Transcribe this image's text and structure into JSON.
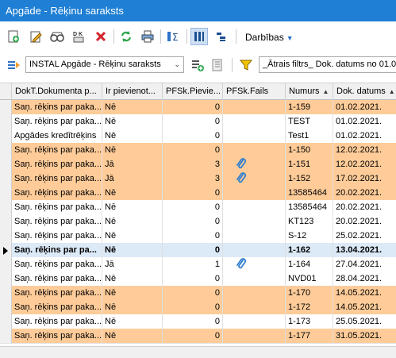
{
  "window": {
    "title": "Apgāde - Rēķinu saraksts"
  },
  "toolbar": {
    "actions_label": "Darbības",
    "icons": [
      "new-doc-icon",
      "edit-icon",
      "view-icon",
      "dk-icon",
      "delete-icon",
      "refresh-icon",
      "print-icon",
      "sum-icon",
      "columns-icon",
      "tree-icon"
    ]
  },
  "toolbar2": {
    "report_select_value": "INSTAL Apgāde - Rēķinu saraksts",
    "filter_text": "_Ātrais filtrs_ Dok. datums no 01.01"
  },
  "colors": {
    "title_bar": "#1e7fd4",
    "row_highlight": "#ffcc99",
    "row_selected": "#dce9f7",
    "attachment": "#2f7fd0"
  },
  "grid": {
    "columns": [
      "DokT.Dokumenta p...",
      "Ir pievienot...",
      "PFSk.Pievie...",
      "PFSk.Fails",
      "Numurs",
      "Dok. datums"
    ],
    "sorted_column_index": 5,
    "rows": [
      {
        "doc": "Saņ. rēķins par paka...",
        "attached": "Nē",
        "count": "0",
        "file": false,
        "number": "1-159",
        "date": "01.02.2021.",
        "style": "orange"
      },
      {
        "doc": "Saņ. rēķins par paka...",
        "attached": "Nē",
        "count": "0",
        "file": false,
        "number": "TEST",
        "date": "01.02.2021.",
        "style": "white"
      },
      {
        "doc": "Apgādes kredītrēķins",
        "attached": "Nē",
        "count": "0",
        "file": false,
        "number": "Test1",
        "date": "01.02.2021.",
        "style": "white"
      },
      {
        "doc": "Saņ. rēķins par paka...",
        "attached": "Nē",
        "count": "0",
        "file": false,
        "number": "1-150",
        "date": "12.02.2021.",
        "style": "orange"
      },
      {
        "doc": "Saņ. rēķins par paka...",
        "attached": "Jā",
        "count": "3",
        "file": true,
        "number": "1-151",
        "date": "12.02.2021.",
        "style": "orange"
      },
      {
        "doc": "Saņ. rēķins par paka...",
        "attached": "Jā",
        "count": "3",
        "file": true,
        "number": "1-152",
        "date": "17.02.2021.",
        "style": "orange"
      },
      {
        "doc": "Saņ. rēķins par paka...",
        "attached": "Nē",
        "count": "0",
        "file": false,
        "number": "13585464",
        "date": "20.02.2021.",
        "style": "orange"
      },
      {
        "doc": "Saņ. rēķins par paka...",
        "attached": "Nē",
        "count": "0",
        "file": false,
        "number": "13585464",
        "date": "20.02.2021.",
        "style": "white"
      },
      {
        "doc": "Saņ. rēķins par paka...",
        "attached": "Nē",
        "count": "0",
        "file": false,
        "number": "KT123",
        "date": "20.02.2021.",
        "style": "white"
      },
      {
        "doc": "Saņ. rēķins par paka...",
        "attached": "Nē",
        "count": "0",
        "file": false,
        "number": "S-12",
        "date": "25.02.2021.",
        "style": "white"
      },
      {
        "doc": "Saņ. rēķins par pa...",
        "attached": "Nē",
        "count": "0",
        "file": false,
        "number": "1-162",
        "date": "13.04.2021.",
        "style": "sel",
        "current": true
      },
      {
        "doc": "Saņ. rēķins par paka...",
        "attached": "Jā",
        "count": "1",
        "file": true,
        "number": "1-164",
        "date": "27.04.2021.",
        "style": "white"
      },
      {
        "doc": "Saņ. rēķins par paka...",
        "attached": "Nē",
        "count": "0",
        "file": false,
        "number": "NVD01",
        "date": "28.04.2021.",
        "style": "white"
      },
      {
        "doc": "Saņ. rēķins par paka...",
        "attached": "Nē",
        "count": "0",
        "file": false,
        "number": "1-170",
        "date": "14.05.2021.",
        "style": "orange"
      },
      {
        "doc": "Saņ. rēķins par paka...",
        "attached": "Nē",
        "count": "0",
        "file": false,
        "number": "1-172",
        "date": "14.05.2021.",
        "style": "orange"
      },
      {
        "doc": "Saņ. rēķins par paka...",
        "attached": "Nē",
        "count": "0",
        "file": false,
        "number": "1-173",
        "date": "25.05.2021.",
        "style": "white"
      },
      {
        "doc": "Saņ. rēķins par paka...",
        "attached": "Nē",
        "count": "0",
        "file": false,
        "number": "1-177",
        "date": "31.05.2021.",
        "style": "orange"
      }
    ]
  }
}
